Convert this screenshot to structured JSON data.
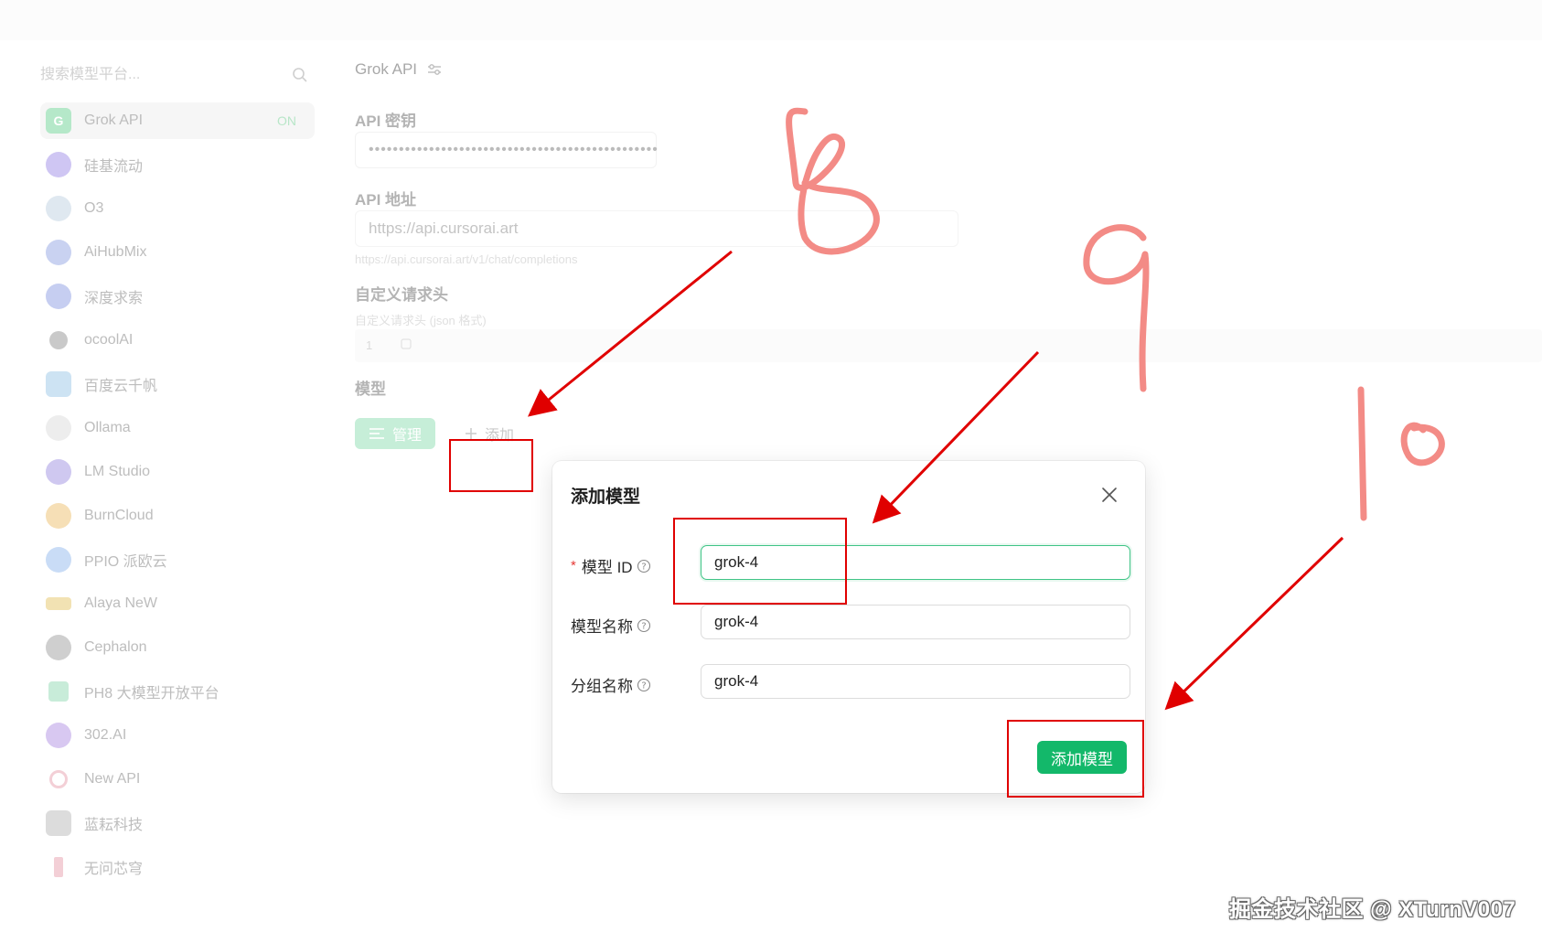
{
  "search": {
    "placeholder": "搜索模型平台..."
  },
  "sidebar": {
    "items": [
      {
        "label": "Grok API",
        "badge": "ON",
        "icon": "grok-logo-icon",
        "color": "#b5e8c9"
      },
      {
        "label": "硅基流动",
        "icon": "siliconflow-logo-icon",
        "color": "#cfc6f3"
      },
      {
        "label": "O3",
        "icon": "o3-logo-icon",
        "color": "#dfe8f0"
      },
      {
        "label": "AiHubMix",
        "icon": "aihubmix-logo-icon",
        "color": "#c9d2f1"
      },
      {
        "label": "深度求索",
        "icon": "deepseek-logo-icon",
        "color": "#c6cef1"
      },
      {
        "label": "ocoolAI",
        "icon": "ocoolai-logo-icon",
        "color": "#c9c9c9"
      },
      {
        "label": "百度云千帆",
        "icon": "baidu-qianfan-logo-icon",
        "color": "#cde3f3"
      },
      {
        "label": "Ollama",
        "icon": "ollama-logo-icon",
        "color": "#ededed"
      },
      {
        "label": "LM Studio",
        "icon": "lmstudio-logo-icon",
        "color": "#cfc8f0"
      },
      {
        "label": "BurnCloud",
        "icon": "burncloud-logo-icon",
        "color": "#f6dfb6"
      },
      {
        "label": "PPIO 派欧云",
        "icon": "ppio-logo-icon",
        "color": "#c9dcf6"
      },
      {
        "label": "Alaya NeW",
        "icon": "alaya-logo-icon",
        "color": "#f2e2b3"
      },
      {
        "label": "Cephalon",
        "icon": "cephalon-logo-icon",
        "color": "#cfcfcf"
      },
      {
        "label": "PH8 大模型开放平台",
        "icon": "ph8-logo-icon",
        "color": "#c8ecd9"
      },
      {
        "label": "302.AI",
        "icon": "302ai-logo-icon",
        "color": "#d8c8f1"
      },
      {
        "label": "New API",
        "icon": "newapi-logo-icon",
        "color": "#f3cfd6"
      },
      {
        "label": "蓝耘科技",
        "icon": "lanyun-logo-icon",
        "color": "#dcdcdc"
      },
      {
        "label": "无问芯穹",
        "icon": "infini-logo-icon",
        "color": "#f3cfd6"
      }
    ]
  },
  "main": {
    "title": "Grok API",
    "api_key_label": "API 密钥",
    "api_key_value": "••••••••••••••••••••••••••••••••••••••••••••••••",
    "api_url_label": "API 地址",
    "api_url_value": "https://api.cursorai.art",
    "api_url_hint": "https://api.cursorai.art/v1/chat/completions",
    "headers_label": "自定义请求头",
    "headers_hint": "自定义请求头 (json 格式)",
    "line_number": "1",
    "models_label": "模型",
    "manage_label": "管理",
    "add_label": "添加"
  },
  "modal": {
    "title": "添加模型",
    "required_mark": "*",
    "model_id_label": "模型 ID",
    "model_id_value": "grok-4",
    "model_name_label": "模型名称",
    "model_name_value": "grok-4",
    "group_name_label": "分组名称",
    "group_name_value": "grok-4",
    "submit_label": "添加模型"
  },
  "annotations": {
    "step_labels": [
      "8",
      "9",
      "10"
    ],
    "color": "#e8534f",
    "arrow_color": "#e00000"
  },
  "watermark": "掘金技术社区 @ XTurnV007"
}
